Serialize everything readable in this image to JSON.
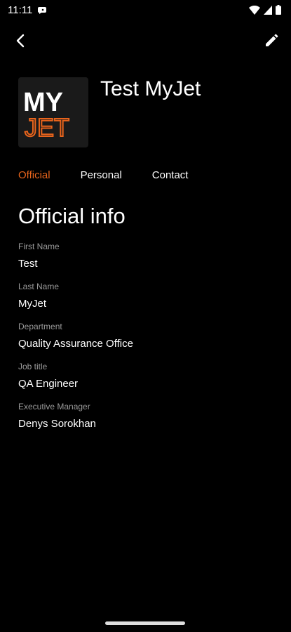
{
  "status_bar": {
    "time": "11:11"
  },
  "profile": {
    "name": "Test MyJet",
    "logo": {
      "line1": "MY",
      "line2": "JET"
    }
  },
  "tabs": [
    {
      "label": "Official",
      "active": true
    },
    {
      "label": "Personal",
      "active": false
    },
    {
      "label": "Contact",
      "active": false
    }
  ],
  "section": {
    "title": "Official info"
  },
  "fields": [
    {
      "label": "First Name",
      "value": "Test"
    },
    {
      "label": "Last Name",
      "value": "MyJet"
    },
    {
      "label": "Department",
      "value": "Quality Assurance Office"
    },
    {
      "label": "Job title",
      "value": "QA Engineer"
    },
    {
      "label": "Executive Manager",
      "value": "Denys Sorokhan"
    }
  ],
  "colors": {
    "accent": "#e8641c",
    "background": "#000000",
    "label": "#9a9a9a"
  },
  "icons": [
    "back-arrow-icon",
    "edit-pencil-icon",
    "wifi-icon",
    "signal-icon",
    "battery-icon",
    "notification-icon"
  ]
}
